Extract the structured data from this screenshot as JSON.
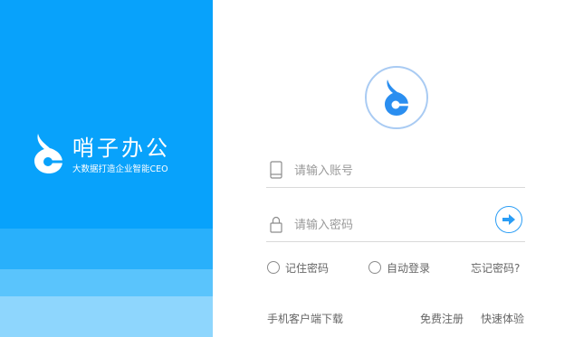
{
  "brand": {
    "name": "哨子办公",
    "slogan": "大数据打造企业智能CEO",
    "logo_icon": "whistle-logo-icon",
    "panel_color": "#08a2fb"
  },
  "login": {
    "avatar_icon": "whistle-logo-icon",
    "account_placeholder": "请输入账号",
    "account_icon": "phone-icon",
    "password_placeholder": "请输入密码",
    "password_icon": "lock-icon",
    "submit_icon": "arrow-right-icon",
    "accent_color": "#2a9df5",
    "remember_label": "记住密码",
    "auto_login_label": "自动登录",
    "forgot_label": "忘记密码?"
  },
  "footer": {
    "download_label": "手机客户端下载",
    "register_label": "免费注册",
    "trial_label": "快速体验"
  }
}
